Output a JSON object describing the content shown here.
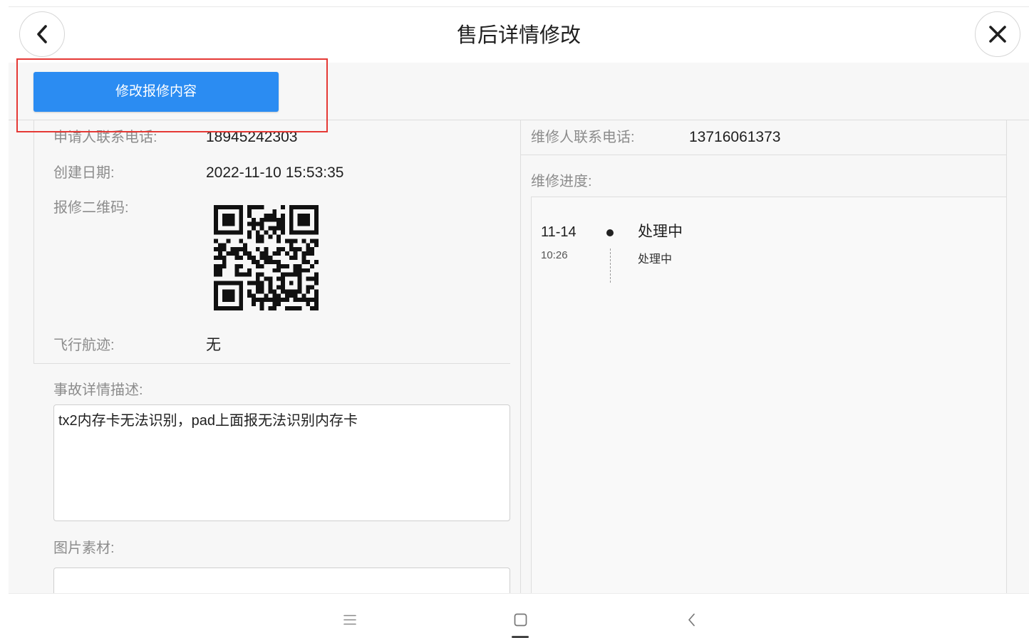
{
  "header": {
    "title": "售后详情修改"
  },
  "toolbar": {
    "edit_button_label": "修改报修内容"
  },
  "left_panel": {
    "applicant_phone": {
      "label": "申请人联系电话:",
      "value": "18945242303"
    },
    "created_date": {
      "label": "创建日期:",
      "value": "2022-11-10 15:53:35"
    },
    "qr_code": {
      "label": "报修二维码:"
    },
    "flight_track": {
      "label": "飞行航迹:",
      "value": "无"
    },
    "accident_description": {
      "label": "事故详情描述:",
      "value": "tx2内存卡无法识别，pad上面报无法识别内存卡"
    },
    "image_material": {
      "label": "图片素材:"
    }
  },
  "right_panel": {
    "repairer_phone": {
      "label": "维修人联系电话:",
      "value": "13716061373"
    },
    "repair_progress": {
      "label": "维修进度:",
      "timeline": [
        {
          "date": "11-14",
          "time": "10:26",
          "title": "处理中",
          "description": "处理中"
        }
      ]
    }
  },
  "icons": {
    "back": "chevron-left-icon",
    "close": "close-icon",
    "nav_menu": "menu-icon",
    "nav_home": "square-icon",
    "nav_back": "chevron-left-icon"
  },
  "colors": {
    "primary": "#2b8cf2",
    "annotation": "#e53935"
  }
}
